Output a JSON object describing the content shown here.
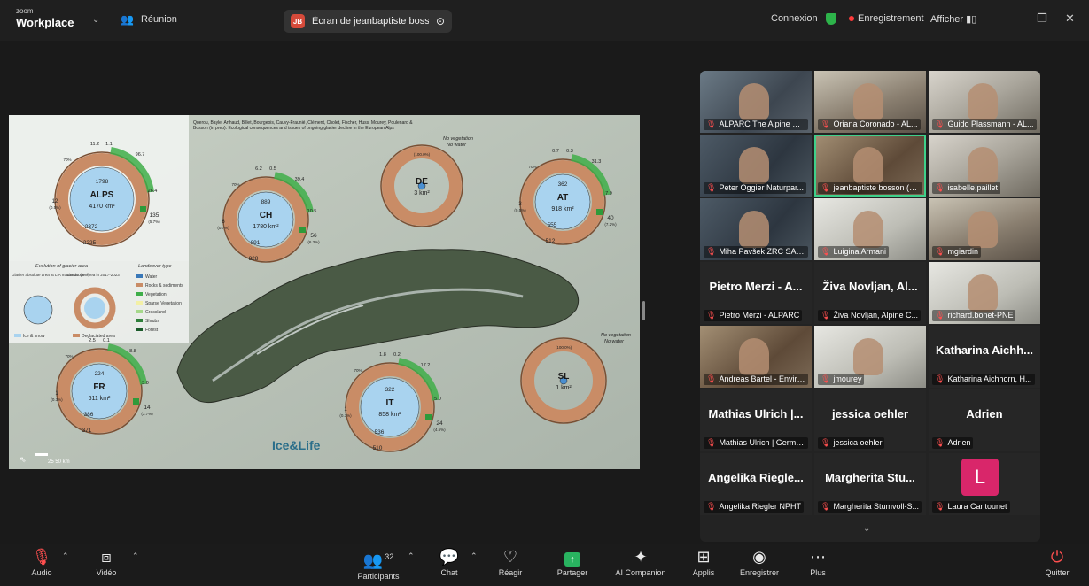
{
  "titlebar": {
    "brand_top": "zoom",
    "brand_bottom": "Workplace",
    "meeting_label": "Réunion",
    "share_badge": "JB",
    "share_text": "Écran de jeanbaptiste bosson (m",
    "connexion": "Connexion",
    "recording": "Enregistrement",
    "view": "Afficher"
  },
  "slide": {
    "credits": "Querou, Bayle, Arthaud, Billet, Bourgeois, Cauvy-Fraunié, Clément, Cholet, Fischer, Huss, Mourey, Poulenard & Bosson (in prep). Ecological consequences and issues of ongoing glacier decline in the European Alps",
    "logo": "Ice&Life",
    "scale": "25   50 km",
    "no_veg": "No vegetation",
    "no_water": "No water",
    "legend_evolution_title": "Evolution of glacier area",
    "legend_landcover_title": "Landcover type",
    "legend_abs": "Glacier absolute area at LIA maximum (km²)",
    "legend_lc": "Landcover area in 2017-2023",
    "legend_items": [
      "Water",
      "Rocks & sediments",
      "Vegetation",
      "Sparse Vegetation",
      "Grassland",
      "Shrubs",
      "Forest"
    ],
    "legend_ice": "Ice & snow",
    "legend_degl": "Deglaciated area",
    "units": "[km²]",
    "donuts": [
      {
        "code": "ALPS",
        "area": "4170 km²",
        "ice": "1798",
        "rock": "2372",
        "rock2": "2225",
        "veg": "135",
        "veg_pct": "(5.7%)",
        "water": "12",
        "water_pct": "(0.5%)",
        "s1": "11.2",
        "s2": "1.1",
        "s3": "96.7",
        "s4": "26.4",
        "s5": "70%"
      },
      {
        "code": "CH",
        "area": "1780 km²",
        "ice": "889",
        "rock": "891",
        "rock2": "828",
        "veg": "56",
        "veg_pct": "(6.3%)",
        "water": "6",
        "water_pct": "(0.7%)",
        "s1": "6.2",
        "s2": "0.5",
        "s3": "39.4",
        "s4": "10.5",
        "s5": "70%"
      },
      {
        "code": "DE",
        "area": "3 km²",
        "pct": "(100.0%)"
      },
      {
        "code": "AT",
        "area": "918 km²",
        "ice": "362",
        "rock": "555",
        "rock2": "512",
        "veg": "40",
        "veg_pct": "(7.2%)",
        "water": "3",
        "water_pct": "(0.5%)",
        "s1": "0.7",
        "s2": "0.3",
        "s3": "31.3",
        "s4": "7.9",
        "s5": "70%"
      },
      {
        "code": "FR",
        "area": "611 km²",
        "ice": "224",
        "rock": "386",
        "rock2": "371",
        "veg": "14",
        "veg_pct": "(3.7%)",
        "water": "1",
        "water_pct": "(0.3%)",
        "s1": "2.5",
        "s2": "0.1",
        "s3": "8.8",
        "s4": "3.0",
        "s5": "70%"
      },
      {
        "code": "IT",
        "area": "858 km²",
        "ice": "322",
        "rock": "536",
        "rock2": "510",
        "veg": "24",
        "veg_pct": "(4.5%)",
        "water": "1",
        "water_pct": "(0.3%)",
        "s1": "1.8",
        "s2": "0.2",
        "s3": "17.2",
        "s4": "5.0",
        "s5": "70%"
      },
      {
        "code": "SL",
        "area": "1 km²",
        "pct": "(100.0%)"
      }
    ]
  },
  "participants": [
    {
      "name": "ALPARC The Alpine Ne...",
      "type": "video",
      "style": "v1"
    },
    {
      "name": "Oriana Coronado - AL...",
      "type": "video",
      "style": "v2"
    },
    {
      "name": "Guido Plassmann - AL...",
      "type": "video",
      "style": "v3"
    },
    {
      "name": "Peter Oggier Naturpar...",
      "type": "video",
      "style": "v4"
    },
    {
      "name": "jeanbaptiste bosson (mar...",
      "type": "video",
      "style": "v5",
      "active": true
    },
    {
      "name": "isabelle.paillet",
      "type": "video",
      "style": "v3"
    },
    {
      "name": "Miha Pavšek ZRC SAZU",
      "type": "video",
      "style": "v4"
    },
    {
      "name": "Luigina Armani",
      "type": "video",
      "style": "v6"
    },
    {
      "name": "mgiardin",
      "type": "video",
      "style": "v2"
    },
    {
      "name": "Pietro Merzi - ALPARC",
      "big": "Pietro Merzi - A...",
      "type": "name"
    },
    {
      "name": "Živa Novljan, Alpine C...",
      "big": "Živa Novljan, Al...",
      "type": "name"
    },
    {
      "name": "richard.bonet-PNE",
      "type": "video",
      "style": "v6"
    },
    {
      "name": "Andreas Bartel - Enviro...",
      "type": "video",
      "style": "v5"
    },
    {
      "name": "jmourey",
      "type": "video",
      "style": "v6"
    },
    {
      "name": "Katharina Aichhorn, H...",
      "big": "Katharina Aichh...",
      "type": "name"
    },
    {
      "name": "Mathias Ulrich | Germa...",
      "big": "Mathias Ulrich |...",
      "type": "name"
    },
    {
      "name": "jessica oehler",
      "big": "jessica oehler",
      "type": "name"
    },
    {
      "name": "Adrien",
      "big": "Adrien",
      "type": "name"
    },
    {
      "name": "Angelika Riegler NPHT",
      "big": "Angelika Riegle...",
      "type": "name"
    },
    {
      "name": "Margherita Stumvoll-S...",
      "big": "Margherita Stu...",
      "type": "name"
    },
    {
      "name": "Laura Cantounet",
      "avatar": "L",
      "type": "avatar"
    }
  ],
  "toolbar": {
    "audio": "Audio",
    "video": "Vidéo",
    "participants": "Participants",
    "participants_count": "32",
    "chat": "Chat",
    "react": "Réagir",
    "share": "Partager",
    "ai": "AI Companion",
    "apps": "Applis",
    "record": "Enregistrer",
    "more": "Plus",
    "quit": "Quitter"
  },
  "colors": {
    "accent_green": "#29b360",
    "rec_red": "#ff3b3b",
    "avatar_pink": "#d9266a",
    "ice": "#a9d3ef",
    "rock": "#c98c66",
    "veg": "#3fae49"
  }
}
